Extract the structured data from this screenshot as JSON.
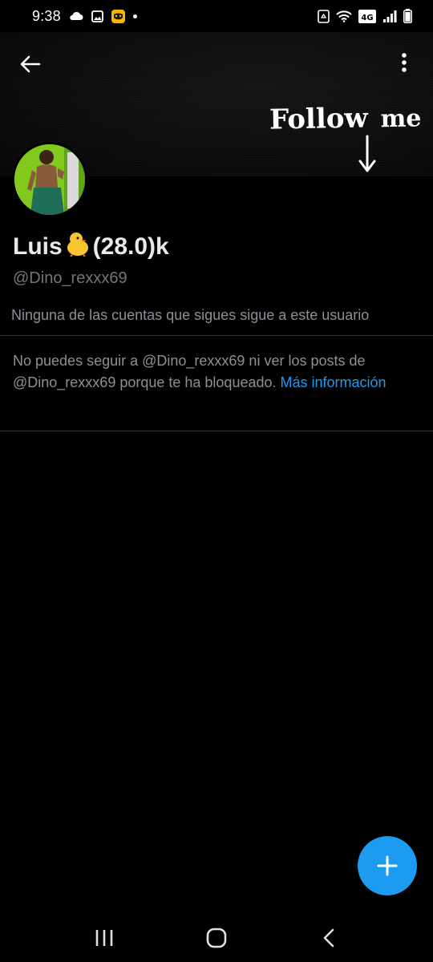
{
  "status_bar": {
    "time": "9:38",
    "left_icons": [
      "cloud-icon",
      "image-icon",
      "app-mask-icon",
      "notification-dot"
    ],
    "right_icons": [
      "recycle-icon",
      "wifi-icon",
      "volte-4g-icon",
      "signal-icon",
      "battery-icon"
    ],
    "network": "4G"
  },
  "header": {
    "back_icon": "arrow-left-icon",
    "more_icon": "more-vertical-icon",
    "banner_text_main": "Follow",
    "banner_text_sub": "me"
  },
  "profile": {
    "name": "Luis",
    "name_emoji": "🐤",
    "name_suffix": "(28.0)k",
    "handle": "@Dino_rexxx69",
    "followers_you_know": "Ninguna de las cuentas que sigues sigue a este usuario"
  },
  "blocked_notice": {
    "text": "No puedes seguir a @Dino_rexxx69 ni ver los posts de @Dino_rexxx69 porque te ha bloqueado.",
    "link": "Más información"
  },
  "fab": {
    "icon": "plus-icon"
  },
  "nav": {
    "recent_icon": "recents-icon",
    "home_icon": "home-icon",
    "back_icon": "back-chevron-icon"
  },
  "colors": {
    "background": "#000000",
    "accent": "#1d9bf0",
    "secondary_text": "#71767b",
    "divider": "#2f3336"
  }
}
